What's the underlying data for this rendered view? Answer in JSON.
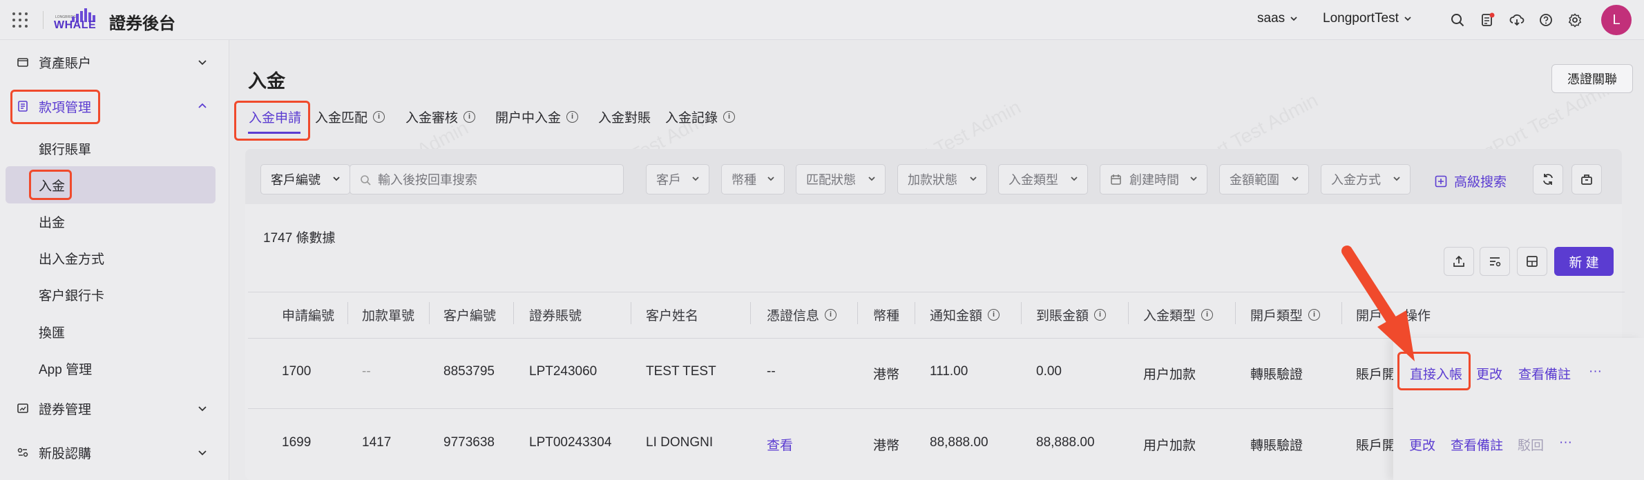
{
  "header": {
    "brand_small": "LONGBRIDGE",
    "brand_word": "WHALE",
    "app_title": "證券後台",
    "env_select": "saas",
    "org_select": "LongportTest",
    "avatar_letter": "L",
    "icons": [
      "apps-grid-icon",
      "search-icon",
      "notification-doc-icon",
      "download-cloud-icon",
      "help-icon",
      "settings-icon"
    ]
  },
  "sidebar": {
    "groups": [
      {
        "label": "資產賬户",
        "icon": "wallet-icon"
      },
      {
        "label": "款項管理",
        "icon": "document-list-icon"
      },
      {
        "label": "證券管理",
        "icon": "chart-icon"
      },
      {
        "label": "新股認購",
        "icon": "ipo-icon"
      }
    ],
    "items": [
      "銀行賬單",
      "入金",
      "出金",
      "出入金方式",
      "客户銀行卡",
      "換匯",
      "App 管理"
    ]
  },
  "page": {
    "title": "入金",
    "link_button": "憑證關聯",
    "tabs": [
      "入金申請",
      "入金匹配",
      "入金審核",
      "開户中入金",
      "入金對賬",
      "入金記錄"
    ]
  },
  "filters": {
    "field_select": "客戶編號",
    "search_placeholder": "輸入後按回車搜索",
    "dropdowns": [
      "客戶",
      "幣種",
      "匹配狀態",
      "加款狀態",
      "入金類型",
      "創建時間",
      "金額範圍",
      "入金方式"
    ],
    "advanced_search": "高級搜索"
  },
  "table": {
    "count_label": "1747 條數據",
    "new_button": "新 建",
    "columns": [
      "申請編號",
      "加款單號",
      "客户編號",
      "證券賬號",
      "客户姓名",
      "憑證信息",
      "幣種",
      "通知金額",
      "到賬金額",
      "入金類型",
      "開戶類型",
      "開戶",
      "操作"
    ],
    "rows": [
      {
        "id": "1700",
        "fund_no": "--",
        "client_no": "8853795",
        "account": "LPT243060",
        "name": "TEST TEST",
        "voucher": "--",
        "currency": "港幣",
        "notice_amt": "111.00",
        "arrived_amt": "0.00",
        "type": "用户加款",
        "open_type": "轉賬驗證",
        "open_extra": "賬戶開",
        "actions": [
          "直接入帳",
          "更改",
          "查看備註",
          "···"
        ]
      },
      {
        "id": "1699",
        "fund_no": "1417",
        "client_no": "9773638",
        "account": "LPT00243304",
        "name": "LI DONGNI",
        "voucher": "查看",
        "currency": "港幣",
        "notice_amt": "88,888.00",
        "arrived_amt": "88,888.00",
        "type": "用户加款",
        "open_type": "轉賬驗證",
        "open_extra": "賬戶開",
        "actions": [
          "更改",
          "查看備註",
          "駁回",
          "···"
        ]
      }
    ]
  },
  "watermark": "LongPort Test Admin",
  "colors": {
    "accent": "#5b3cd1",
    "highlight": "#f04a2c",
    "avatar": "#c2307a"
  }
}
